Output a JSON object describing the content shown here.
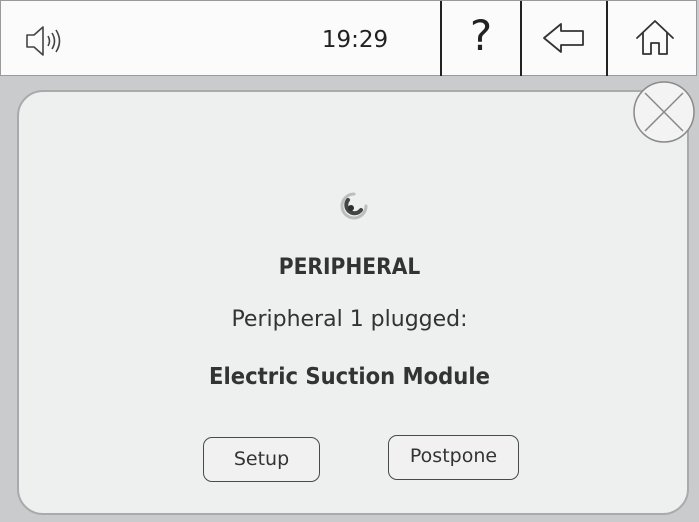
{
  "topbar": {
    "time": "19:29",
    "help_label": "?",
    "icons": {
      "volume": "speaker-icon",
      "back": "arrow-left-icon",
      "home": "home-icon"
    }
  },
  "dialog": {
    "title": "PERIPHERAL",
    "message": "Peripheral 1 plugged:",
    "device_name": "Electric Suction Module",
    "setup_label": "Setup",
    "postpone_label": "Postpone",
    "icons": {
      "close": "close-icon",
      "loading": "spinner-icon"
    }
  },
  "colors": {
    "topbar_bg": "#fbfbfb",
    "screen_bg": "#c9cbcc",
    "dialog_bg": "#eeefef",
    "text": "#333333"
  }
}
